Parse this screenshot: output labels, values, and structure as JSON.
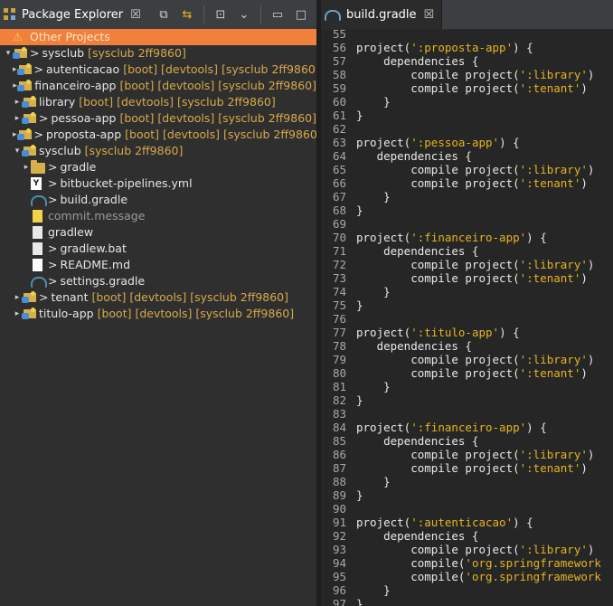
{
  "package_explorer": {
    "title": "Package Explorer",
    "close_glyph": "☒",
    "toolbar": [
      {
        "name": "collapse-all-icon",
        "glyph": "⧉"
      },
      {
        "name": "link-with-editor-icon",
        "glyph": "⇆"
      },
      {
        "name": "focus-icon",
        "glyph": "⊡"
      },
      {
        "name": "view-menu-icon",
        "glyph": "⌄"
      },
      {
        "name": "minimize-icon",
        "glyph": "▭"
      },
      {
        "name": "maximize-icon",
        "glyph": "□"
      }
    ],
    "tree": [
      {
        "depth": 0,
        "arrow": "",
        "icon": "warning",
        "label": "Other Projects",
        "decor": "",
        "selected": true
      },
      {
        "depth": 0,
        "arrow": "▾",
        "icon": "project",
        "prefix": ">",
        "label": "sysclub",
        "decor": "[sysclub 2ff9860]"
      },
      {
        "depth": 1,
        "arrow": "▸",
        "icon": "project",
        "prefix": ">",
        "label": "autenticacao",
        "decor": "[boot] [devtools] [sysclub 2ff9860]"
      },
      {
        "depth": 1,
        "arrow": "▸",
        "icon": "project",
        "prefix": "",
        "label": "financeiro-app",
        "decor": "[boot] [devtools] [sysclub 2ff9860]"
      },
      {
        "depth": 1,
        "arrow": "▸",
        "icon": "project",
        "prefix": "",
        "label": "library",
        "decor": "[boot] [devtools] [sysclub 2ff9860]"
      },
      {
        "depth": 1,
        "arrow": "▸",
        "icon": "project",
        "prefix": ">",
        "label": "pessoa-app",
        "decor": "[boot] [devtools] [sysclub 2ff9860]"
      },
      {
        "depth": 1,
        "arrow": "▸",
        "icon": "project",
        "prefix": ">",
        "label": "proposta-app",
        "decor": "[boot] [devtools] [sysclub 2ff9860]"
      },
      {
        "depth": 1,
        "arrow": "▾",
        "icon": "project",
        "prefix": "",
        "label": "sysclub",
        "decor": "[sysclub 2ff9860]"
      },
      {
        "depth": 2,
        "arrow": "▸",
        "icon": "folder",
        "prefix": ">",
        "label": "gradle",
        "decor": ""
      },
      {
        "depth": 2,
        "arrow": "",
        "icon": "yml",
        "prefix": ">",
        "label": "bitbucket-pipelines.yml",
        "decor": ""
      },
      {
        "depth": 2,
        "arrow": "",
        "icon": "gradle",
        "prefix": ">",
        "label": "build.gradle",
        "decor": ""
      },
      {
        "depth": 2,
        "arrow": "",
        "icon": "txt",
        "prefix": "",
        "label": "commit.message",
        "decor": "",
        "dim": true
      },
      {
        "depth": 2,
        "arrow": "",
        "icon": "file",
        "prefix": "",
        "label": "gradlew",
        "decor": ""
      },
      {
        "depth": 2,
        "arrow": "",
        "icon": "file",
        "prefix": ">",
        "label": "gradlew.bat",
        "decor": ""
      },
      {
        "depth": 2,
        "arrow": "",
        "icon": "md",
        "prefix": ">",
        "label": "README.md",
        "decor": ""
      },
      {
        "depth": 2,
        "arrow": "",
        "icon": "gradle",
        "prefix": ">",
        "label": "settings.gradle",
        "decor": ""
      },
      {
        "depth": 1,
        "arrow": "▸",
        "icon": "project",
        "prefix": ">",
        "label": "tenant",
        "decor": "[boot] [devtools] [sysclub 2ff9860]"
      },
      {
        "depth": 1,
        "arrow": "▸",
        "icon": "project",
        "prefix": "",
        "label": "titulo-app",
        "decor": "[boot] [devtools] [sysclub 2ff9860]"
      }
    ]
  },
  "editor": {
    "tab_title": "build.gradle",
    "close_glyph": "☒",
    "lines": [
      {
        "n": "55",
        "t": ""
      },
      {
        "n": "56",
        "t": "project(':proposta-app') {"
      },
      {
        "n": "57",
        "t": "    dependencies {"
      },
      {
        "n": "58",
        "t": "        compile project(':library')"
      },
      {
        "n": "59",
        "t": "        compile project(':tenant')"
      },
      {
        "n": "60",
        "t": "    }"
      },
      {
        "n": "61",
        "t": "}"
      },
      {
        "n": "62",
        "t": ""
      },
      {
        "n": "63",
        "t": "project(':pessoa-app') {"
      },
      {
        "n": "64",
        "t": "   dependencies {"
      },
      {
        "n": "65",
        "t": "        compile project(':library')"
      },
      {
        "n": "66",
        "t": "        compile project(':tenant')"
      },
      {
        "n": "67",
        "t": "    }"
      },
      {
        "n": "68",
        "t": "}"
      },
      {
        "n": "69",
        "t": ""
      },
      {
        "n": "70",
        "t": "project(':financeiro-app') {"
      },
      {
        "n": "71",
        "t": "    dependencies {"
      },
      {
        "n": "72",
        "t": "        compile project(':library')"
      },
      {
        "n": "73",
        "t": "        compile project(':tenant')"
      },
      {
        "n": "74",
        "t": "    }"
      },
      {
        "n": "75",
        "t": "}"
      },
      {
        "n": "76",
        "t": ""
      },
      {
        "n": "77",
        "t": "project(':titulo-app') {"
      },
      {
        "n": "78",
        "t": "   dependencies {"
      },
      {
        "n": "79",
        "t": "        compile project(':library')"
      },
      {
        "n": "80",
        "t": "        compile project(':tenant')"
      },
      {
        "n": "81",
        "t": "    }"
      },
      {
        "n": "82",
        "t": "}"
      },
      {
        "n": "83",
        "t": ""
      },
      {
        "n": "84",
        "t": "project(':financeiro-app') {"
      },
      {
        "n": "85",
        "t": "    dependencies {"
      },
      {
        "n": "86",
        "t": "        compile project(':library')"
      },
      {
        "n": "87",
        "t": "        compile project(':tenant')"
      },
      {
        "n": "88",
        "t": "    }"
      },
      {
        "n": "89",
        "t": "}"
      },
      {
        "n": "90",
        "t": ""
      },
      {
        "n": "91",
        "t": "project(':autenticacao') {"
      },
      {
        "n": "92",
        "t": "    dependencies {"
      },
      {
        "n": "93",
        "t": "        compile project(':library')"
      },
      {
        "n": "94",
        "t": "        compile('org.springframework"
      },
      {
        "n": "95",
        "t": "        compile('org.springframework"
      },
      {
        "n": "96",
        "t": "    }"
      },
      {
        "n": "97",
        "t": "}"
      }
    ]
  },
  "colors": {
    "selection": "#f0803c",
    "decorator": "#d9a84a",
    "string": "#e6b422"
  }
}
